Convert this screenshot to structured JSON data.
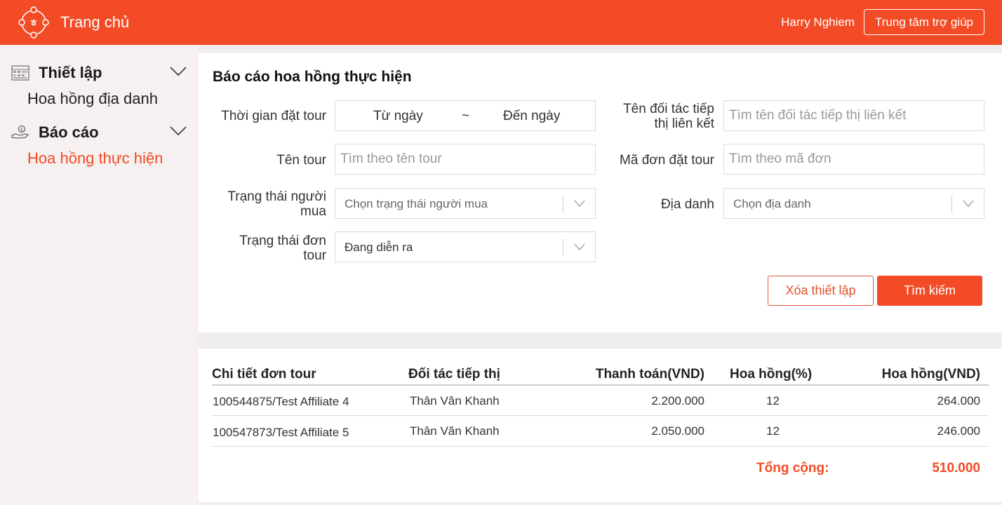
{
  "header": {
    "brand": "Trang chủ",
    "user_name": "Harry Nghiem",
    "help_button": "Trung tâm trợ giúp",
    "logo_text": "ㅎ"
  },
  "sidebar": {
    "groups": [
      {
        "title": "Thiết lập",
        "icon": "settings-grid-icon",
        "items": [
          {
            "label": "Hoa hồng địa danh",
            "active": false
          }
        ]
      },
      {
        "title": "Báo cáo",
        "icon": "hand-money-icon",
        "items": [
          {
            "label": "Hoa hồng thực hiện",
            "active": true
          }
        ]
      }
    ]
  },
  "filters": {
    "title": "Báo cáo hoa hồng thực hiện",
    "booking_time": {
      "label": "Thời gian đặt tour",
      "from": "Từ ngày",
      "sep": "~",
      "to": "Đến ngày"
    },
    "partner": {
      "label_line1": "Tên đối tác tiếp",
      "label_line2": "thị liên kết",
      "placeholder": "Tìm tên đối tác tiếp thị liên kết"
    },
    "tour_name": {
      "label": "Tên tour",
      "placeholder": "Tìm theo tên tour"
    },
    "order_code": {
      "label": "Mã đơn đặt tour",
      "placeholder": "Tìm theo mã đơn"
    },
    "buyer_status": {
      "label_line1": "Trạng thái người",
      "label_line2": "mua",
      "placeholder": "Chọn trạng thái người mua"
    },
    "destination": {
      "label": "Địa danh",
      "placeholder": "Chọn địa danh"
    },
    "order_status": {
      "label_line1": "Trạng thái đơn",
      "label_line2": "tour",
      "value": "Đang diễn ra"
    },
    "reset_button": "Xóa thiết lập",
    "search_button": "Tìm kiếm"
  },
  "table": {
    "columns": [
      "Chi tiết đơn tour",
      "Đối tác tiếp thị",
      "Thanh toán(VND)",
      "Hoa hồng(%)",
      "Hoa hồng(VND)"
    ],
    "rows": [
      [
        "100544875/Test Affiliate 4",
        "Thân Văn Khanh",
        "2.200.000",
        "12",
        "264.000"
      ],
      [
        "100547873/Test Affiliate 5",
        "Thân Văn Khanh",
        "2.050.000",
        "12",
        "246.000"
      ]
    ],
    "total_label": "Tổng cộng:",
    "total_value": "510.000"
  },
  "colors": {
    "accent": "#f24b25",
    "sidebar_bg": "#f7f0f0"
  }
}
